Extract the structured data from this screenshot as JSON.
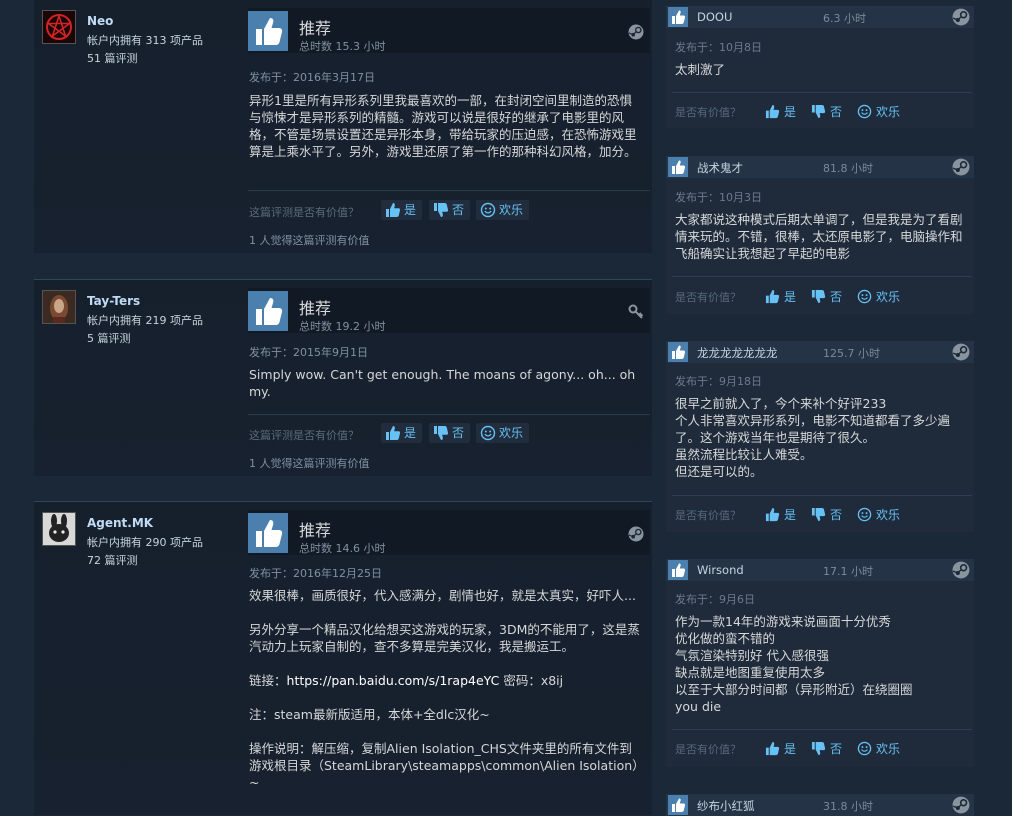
{
  "colors": {
    "background": "#1b2838",
    "accent": "#66c0f4",
    "thumb_bg": "#4b7fad"
  },
  "reviews": [
    {
      "user": "Neo",
      "products": "帐户内拥有 313 项产品",
      "review_count": "51 篇评测",
      "avatar_icon": "pentagram-avatar",
      "verdict": "推荐",
      "hours": "总时数 15.3 小时",
      "header_icon": "steam-icon",
      "posted": "发布于：2016年3月17日",
      "content": [
        "异形1里是所有异形系列里我最喜欢的一部，在封闭空间里制造的恐惧与惊悚才是异形系列的精髓。游戏可以说是很好的继承了电影里的风格，不管是场景设置还是异形本身，带给玩家的压迫感，在恐怖游戏里算是上乘水平了。另外，游戏里还原了第一作的那种科幻风格，加分。"
      ],
      "helpful_q": "这篇评测是否有价值？",
      "yes": "是",
      "no": "否",
      "funny": "欢乐",
      "footnote": "1 人觉得这篇评测有价值"
    },
    {
      "user": "Tay-Ters",
      "products": "帐户内拥有 219 项产品",
      "review_count": "5 篇评测",
      "avatar_icon": "portrait-avatar",
      "verdict": "推荐",
      "hours": "总时数 19.2 小时",
      "header_icon": "key-icon",
      "posted": "发布于：2015年9月1日",
      "content": [
        "Simply wow. Can't get enough. The moans of agony... oh... oh my."
      ],
      "helpful_q": "这篇评测是否有价值？",
      "yes": "是",
      "no": "否",
      "funny": "欢乐",
      "footnote": "1 人觉得这篇评测有价值"
    },
    {
      "user": "Agent.MK",
      "products": "帐户内拥有 290 项产品",
      "review_count": "72 篇评测",
      "avatar_icon": "rabbit-avatar",
      "verdict": "推荐",
      "hours": "总时数 14.6 小时",
      "header_icon": "steam-icon",
      "posted": "发布于：2016年12月25日",
      "content": [
        "效果很棒，画质很好，代入感满分，剧情也好，就是太真实，好吓人...",
        "另外分享一个精品汉化给想买这游戏的玩家，3DM的不能用了，这是蒸汽动力上玩家自制的，查不多算是完美汉化，我是搬运工。",
        "链接：",
        "https://pan.baidu.com/s/1rap4eYC",
        " 密码：x8ij",
        "注：steam最新版适用，本体+全dlc汉化~",
        "操作说明：解压缩，复制Alien Isolation_CHS文件夹里的所有文件到游戏根目录（SteamLibrary\\steamapps\\common\\Alien Isolation）~"
      ]
    }
  ],
  "side_reviews": [
    {
      "user": "DOOU",
      "hours": "6.3 小时",
      "posted": "发布于：10月8日",
      "content": [
        "太刺激了"
      ],
      "helpful_q": "是否有价值？",
      "yes": "是",
      "no": "否",
      "funny": "欢乐"
    },
    {
      "user": "战术鬼才",
      "hours": "81.8 小时",
      "posted": "发布于：10月3日",
      "content": [
        "大家都说这种模式后期太单调了，但是我是为了看剧情来玩的。不错，很棒，太还原电影了，电脑操作和飞船确实让我想起了早起的电影"
      ],
      "helpful_q": "是否有价值？",
      "yes": "是",
      "no": "否",
      "funny": "欢乐"
    },
    {
      "user": "龙龙龙龙龙龙龙",
      "hours": "125.7 小时",
      "posted": "发布于：9月18日",
      "content": [
        "很早之前就入了，今个来补个好评233",
        "个人非常喜欢异形系列，电影不知道都看了多少遍了。这个游戏当年也是期待了很久。",
        "虽然流程比较让人难受。",
        "但还是可以的。"
      ],
      "helpful_q": "是否有价值？",
      "yes": "是",
      "no": "否",
      "funny": "欢乐"
    },
    {
      "user": "Wirsond",
      "hours": "17.1 小时",
      "posted": "发布于：9月6日",
      "content": [
        "作为一款14年的游戏来说画面十分优秀",
        "优化做的蛮不错的",
        "气氛渲染特别好 代入感很强",
        "缺点就是地图重复使用太多",
        "以至于大部分时间都（异形附近）在绕圈圈",
        "you die"
      ],
      "helpful_q": "是否有价值？",
      "yes": "是",
      "no": "否",
      "funny": "欢乐"
    },
    {
      "user": "纱布小红狐",
      "hours": "31.8 小时"
    }
  ]
}
